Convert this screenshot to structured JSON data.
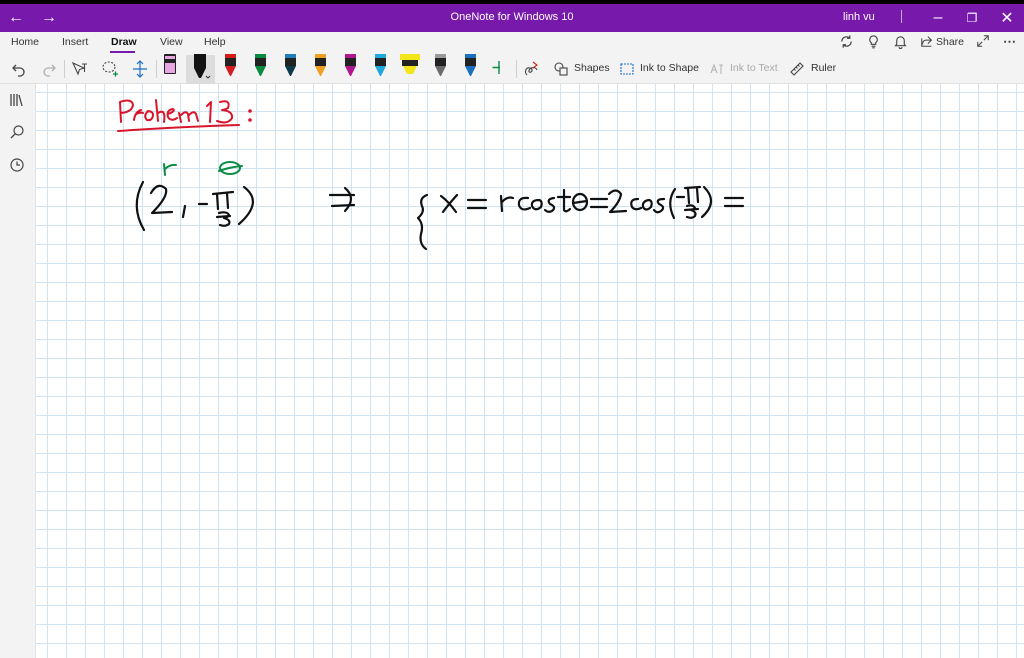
{
  "window": {
    "title": "OneNote for Windows 10",
    "user": "linh vu"
  },
  "menu": {
    "tabs": [
      {
        "label": "Home"
      },
      {
        "label": "Insert"
      },
      {
        "label": "Draw",
        "active": true
      },
      {
        "label": "View"
      },
      {
        "label": "Help"
      }
    ],
    "share_label": "Share"
  },
  "toolbar": {
    "shapes_label": "Shapes",
    "ink_to_shape_label": "Ink to Shape",
    "ink_to_text_label": "Ink to Text",
    "ruler_label": "Ruler",
    "pens": [
      {
        "icon": "highlighter-pink-icon",
        "color": "#e7a6e0"
      },
      {
        "icon": "pen-black-selected-icon",
        "color": "#111111"
      },
      {
        "icon": "pen-red-icon",
        "color": "#d11d1d"
      },
      {
        "icon": "pen-green-icon",
        "color": "#0a8a3c"
      },
      {
        "icon": "pen-dark-teal-icon",
        "color": "#0f3a4d"
      },
      {
        "icon": "pen-orange-icon",
        "color": "#f0a020"
      },
      {
        "icon": "pen-magenta-icon",
        "color": "#b0178e"
      },
      {
        "icon": "pen-cyan-icon",
        "color": "#1fa8dd"
      },
      {
        "icon": "highlighter-yellow-icon",
        "color": "#f3e51c"
      },
      {
        "icon": "pen-gray-icon",
        "color": "#6b6b6b"
      },
      {
        "icon": "pen-blue-icon",
        "color": "#1b6fc0"
      }
    ]
  },
  "canvas": {
    "ink_colors": {
      "red": "#d8152a",
      "green": "#0c8b45",
      "black": "#111111"
    }
  }
}
